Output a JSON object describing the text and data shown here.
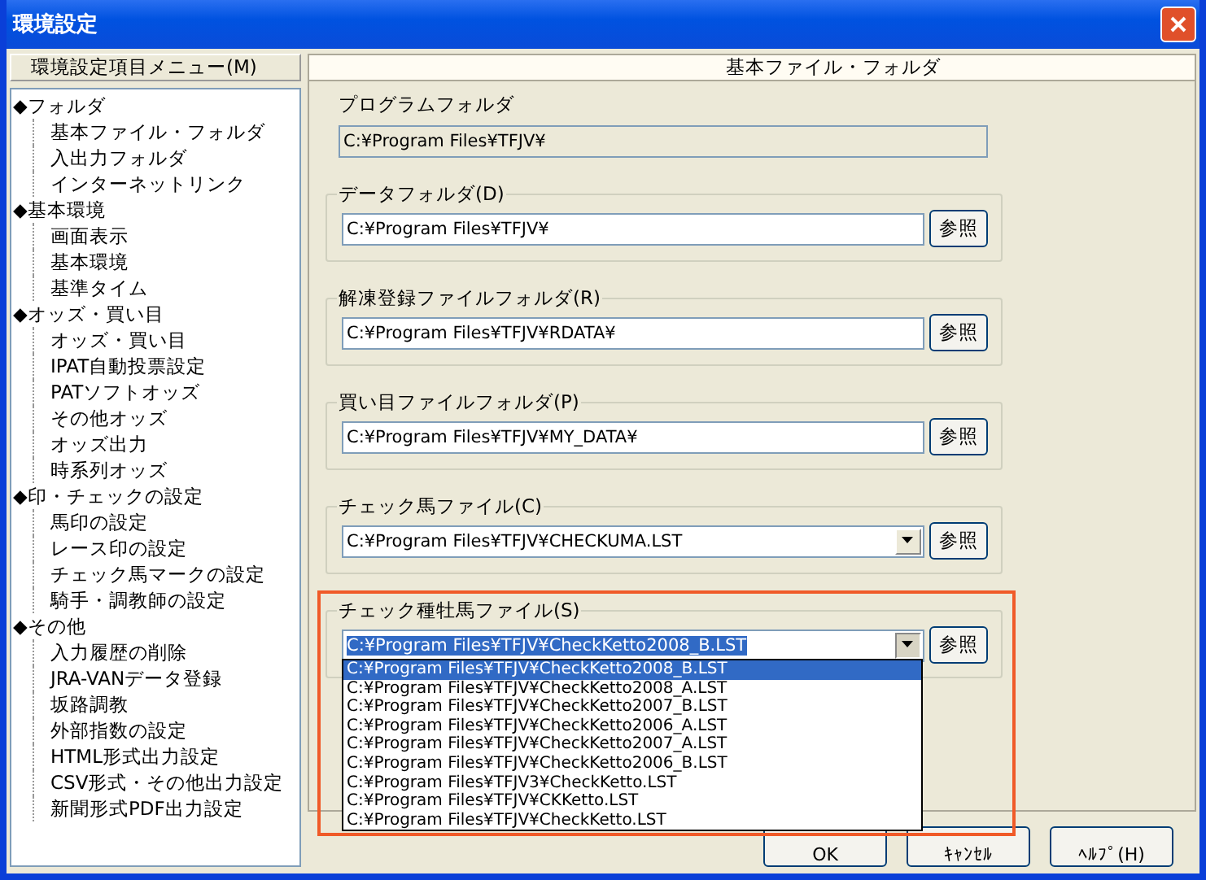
{
  "window": {
    "title": "環境設定"
  },
  "menu": {
    "title": "環境設定項目メニュー(M)",
    "tree": [
      {
        "label": "◆フォルダ",
        "children": [
          {
            "label": "基本ファイル・フォルダ"
          },
          {
            "label": "入出力フォルダ"
          },
          {
            "label": "インターネットリンク"
          }
        ]
      },
      {
        "label": "◆基本環境",
        "children": [
          {
            "label": "画面表示"
          },
          {
            "label": "基本環境"
          },
          {
            "label": "基準タイム"
          }
        ]
      },
      {
        "label": "◆オッズ・買い目",
        "children": [
          {
            "label": "オッズ・買い目"
          },
          {
            "label": "IPAT自動投票設定"
          },
          {
            "label": "PATソフトオッズ"
          },
          {
            "label": "その他オッズ"
          },
          {
            "label": "オッズ出力"
          },
          {
            "label": "時系列オッズ"
          }
        ]
      },
      {
        "label": "◆印・チェックの設定",
        "children": [
          {
            "label": "馬印の設定"
          },
          {
            "label": "レース印の設定"
          },
          {
            "label": "チェック馬マークの設定"
          },
          {
            "label": "騎手・調教師の設定"
          }
        ]
      },
      {
        "label": "◆その他",
        "children": [
          {
            "label": "入力履歴の削除"
          },
          {
            "label": "JRA-VANデータ登録"
          },
          {
            "label": "坂路調教"
          },
          {
            "label": "外部指数の設定"
          },
          {
            "label": "HTML形式出力設定"
          },
          {
            "label": "CSV形式・その他出力設定"
          },
          {
            "label": "新聞形式PDF出力設定"
          }
        ]
      }
    ]
  },
  "page": {
    "title": "基本ファイル・フォルダ",
    "fields": [
      {
        "kind": "readonly",
        "label": "プログラムフォルダ",
        "value": "C:¥Program Files¥TFJV¥"
      },
      {
        "kind": "text",
        "label": "データフォルダ(D)",
        "value": "C:¥Program Files¥TFJV¥",
        "button": "参照"
      },
      {
        "kind": "text",
        "label": "解凍登録ファイルフォルダ(R)",
        "value": "C:¥Program Files¥TFJV¥RDATA¥",
        "button": "参照"
      },
      {
        "kind": "text",
        "label": "買い目ファイルフォルダ(P)",
        "value": "C:¥Program Files¥TFJV¥MY_DATA¥",
        "button": "参照"
      },
      {
        "kind": "combo",
        "label": "チェック馬ファイル(C)",
        "value": "C:¥Program Files¥TFJV¥CHECKUMA.LST",
        "button": "参照",
        "expanded": false
      },
      {
        "kind": "combo",
        "label": "チェック種牡馬ファイル(S)",
        "value": "C:¥Program Files¥TFJV¥CheckKetto2008_B.LST",
        "button": "参照",
        "expanded": true,
        "highlighted": true,
        "options": [
          {
            "label": "C:¥Program Files¥TFJV¥CheckKetto2008_B.LST",
            "selected": true
          },
          {
            "label": "C:¥Program Files¥TFJV¥CheckKetto2008_A.LST",
            "selected": false
          },
          {
            "label": "C:¥Program Files¥TFJV¥CheckKetto2007_B.LST",
            "selected": false
          },
          {
            "label": "C:¥Program Files¥TFJV¥CheckKetto2006_A.LST",
            "selected": false
          },
          {
            "label": "C:¥Program Files¥TFJV¥CheckKetto2007_A.LST",
            "selected": false
          },
          {
            "label": "C:¥Program Files¥TFJV¥CheckKetto2006_B.LST",
            "selected": false
          },
          {
            "label": "C:¥Program Files¥TFJV3¥CheckKetto.LST",
            "selected": false
          },
          {
            "label": "C:¥Program Files¥TFJV¥CKKetto.LST",
            "selected": false
          },
          {
            "label": "C:¥Program Files¥TFJV¥CheckKetto.LST",
            "selected": false
          }
        ]
      }
    ]
  },
  "buttons": [
    "OK",
    "ｷｬﾝｾﾙ",
    "ﾍﾙﾌﾟ(H)"
  ]
}
